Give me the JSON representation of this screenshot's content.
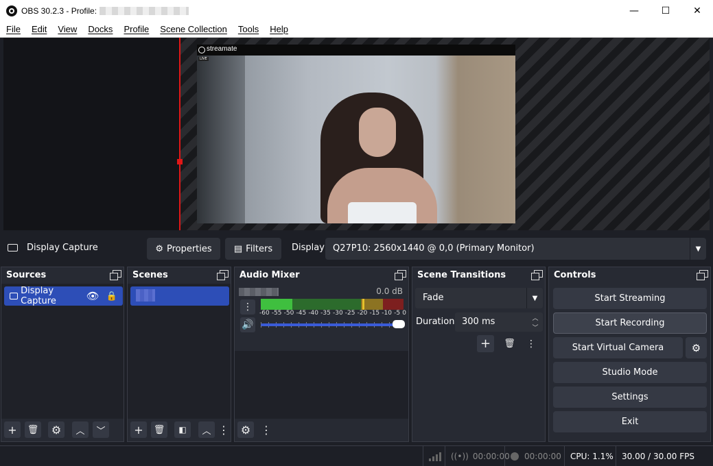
{
  "window": {
    "title": "OBS 30.2.3 - Profile:",
    "minimize_glyph": "—",
    "maximize_glyph": "☐",
    "close_glyph": "✕"
  },
  "menu": [
    "File",
    "Edit",
    "View",
    "Docks",
    "Profile",
    "Scene Collection",
    "Tools",
    "Help"
  ],
  "preview": {
    "watermark": "streamate",
    "live_badge": "LIVE"
  },
  "source_toolbar": {
    "source_name": "Display Capture",
    "properties_label": "Properties",
    "filters_label": "Filters",
    "display_label": "Display",
    "display_value": "Q27P10: 2560x1440 @ 0,0 (Primary Monitor)"
  },
  "sources": {
    "title": "Sources",
    "items": [
      {
        "name": "Display Capture"
      }
    ]
  },
  "scenes": {
    "title": "Scenes"
  },
  "audio_mixer": {
    "title": "Audio Mixer",
    "db_value": "0.0 dB",
    "scale": [
      "-60",
      "-55",
      "-50",
      "-45",
      "-40",
      "-35",
      "-30",
      "-25",
      "-20",
      "-15",
      "-10",
      "-5",
      "0"
    ]
  },
  "transitions": {
    "title": "Scene Transitions",
    "selected": "Fade",
    "duration_label": "Duration",
    "duration_value": "300 ms"
  },
  "controls": {
    "title": "Controls",
    "buttons": [
      "Start Streaming",
      "Start Recording",
      "Start Virtual Camera",
      "Studio Mode",
      "Settings",
      "Exit"
    ]
  },
  "status": {
    "stream_time": "00:00:00",
    "record_time": "00:00:00",
    "cpu": "CPU: 1.1%",
    "fps": "30.00 / 30.00 FPS"
  },
  "colors": {
    "accent_blue": "#2d4eb7",
    "red_guide": "#e01717",
    "meter_green": "#3fbf3f",
    "meter_yellow": "#c8a42a",
    "meter_red": "#b22a2a"
  }
}
